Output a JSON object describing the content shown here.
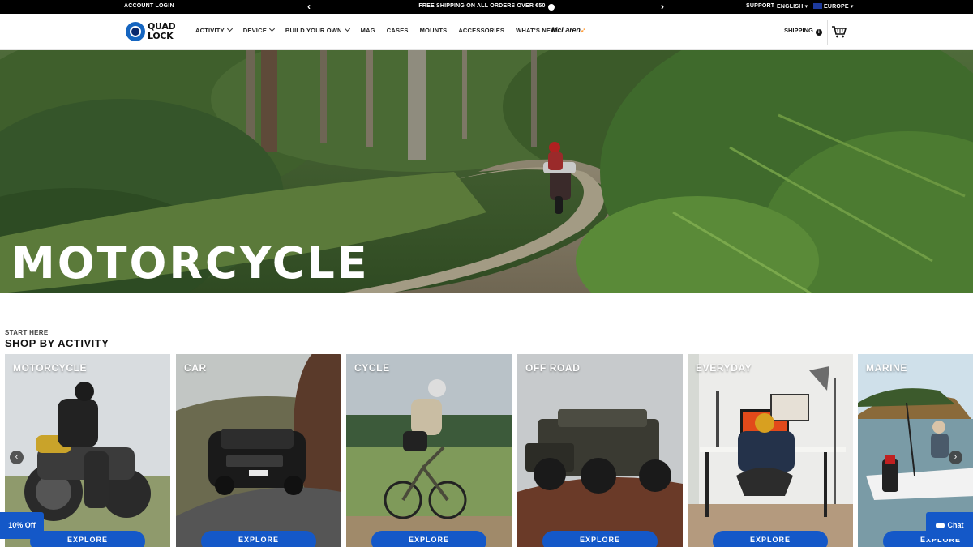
{
  "topbar": {
    "account_login": "ACCOUNT LOGIN",
    "promo": "FREE SHIPPING ON ALL ORDERS OVER €50",
    "promo_info": "i",
    "prev": "‹",
    "next": "›",
    "support": "SUPPORT",
    "language": "ENGLISH ▾",
    "region": "EUROPE ▾"
  },
  "nav": {
    "logo_line1": "QUAD",
    "logo_line2": "LOCK",
    "items": [
      "ACTIVITY",
      "DEVICE",
      "BUILD YOUR OWN",
      "MAG",
      "CASES",
      "MOUNTS",
      "ACCESSORIES",
      "WHAT'S NEW"
    ],
    "mclaren": "McLaren",
    "shipping": "SHIPPING",
    "shipping_info": "i"
  },
  "hero": {
    "title": "MOTORCYCLE"
  },
  "section": {
    "eyebrow": "START HERE",
    "title": "SHOP BY ACTIVITY"
  },
  "cards": [
    {
      "label": "MOTORCYCLE",
      "cta": "EXPLORE"
    },
    {
      "label": "CAR",
      "cta": "EXPLORE"
    },
    {
      "label": "CYCLE",
      "cta": "EXPLORE"
    },
    {
      "label": "OFF ROAD",
      "cta": "EXPLORE"
    },
    {
      "label": "EVERYDAY",
      "cta": "EXPLORE"
    },
    {
      "label": "MARINE",
      "cta": "EXPLORE"
    }
  ],
  "carousel": {
    "prev": "‹",
    "next": "›"
  },
  "widgets": {
    "discount": "10% Off",
    "chat": "Chat"
  },
  "colors": {
    "brand_blue": "#1458c8",
    "topbar": "#000000",
    "mclaren_orange": "#ff8000"
  }
}
